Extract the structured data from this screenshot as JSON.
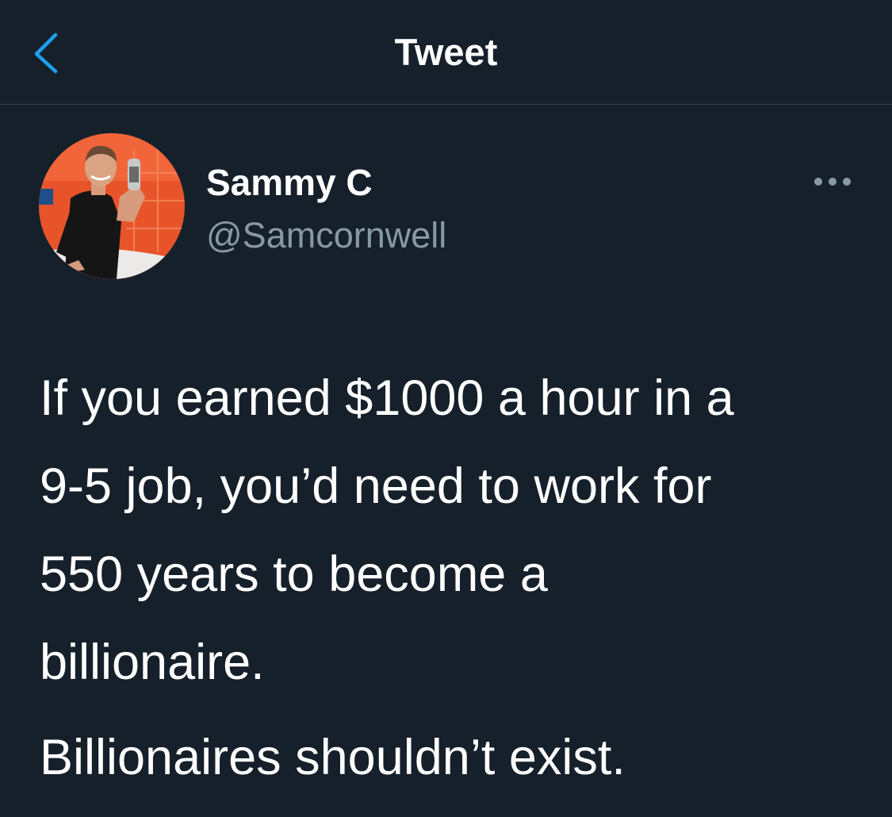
{
  "header": {
    "title": "Tweet",
    "back_icon": "chevron-left-icon",
    "accent_color": "#1da1f2"
  },
  "tweet": {
    "author": {
      "name": "Sammy C",
      "handle": "@Samcornwell",
      "avatar_icon": "profile-photo"
    },
    "more_icon": "more-options-icon",
    "text": {
      "paragraph_1_lines": [
        "If you earned $1000 a hour in a",
        "9-5 job, you’d need to work for",
        "550 years to become a",
        "billionaire."
      ],
      "paragraph_2": "Billionaires shouldn’t exist."
    }
  },
  "colors": {
    "background": "#16202b",
    "divider": "#38444d",
    "text_primary": "#ffffff",
    "text_secondary": "#8899a6"
  }
}
